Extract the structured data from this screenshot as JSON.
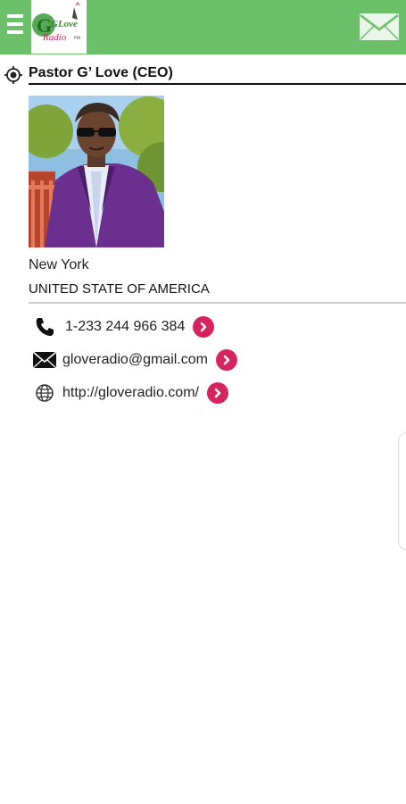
{
  "header": {
    "logo": {
      "text_main": "GLove",
      "text_sub": "Radio",
      "small": "FM"
    },
    "menu_icon": "hamburger-icon",
    "mail_icon": "envelope-icon",
    "bar_color": "#6cc06a"
  },
  "profile": {
    "name": "Pastor G’ Love (CEO)",
    "city": "New York",
    "country": "UNITED STATE OF AMERICA"
  },
  "contacts": [
    {
      "icon": "phone-icon",
      "label": "1-233 244 966 384"
    },
    {
      "icon": "email-icon",
      "label": "gloveradio@gmail.com"
    },
    {
      "icon": "globe-icon",
      "label": "http://gloveradio.com/"
    }
  ],
  "accent_color": "#d6245f"
}
